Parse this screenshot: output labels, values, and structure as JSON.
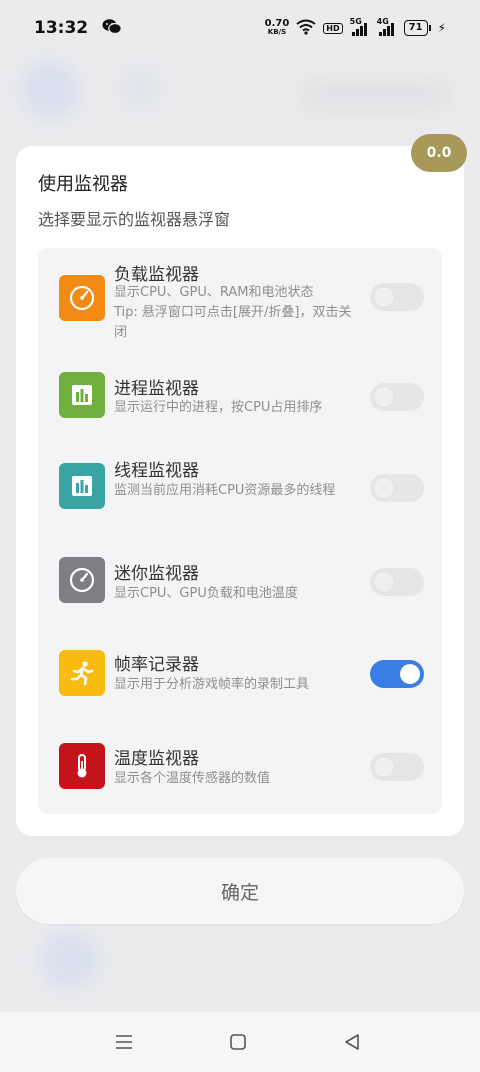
{
  "status_bar": {
    "time": "13:32",
    "speed_value": "0.70",
    "speed_unit": "KB/S",
    "hd_label": "HD",
    "net1": "5G",
    "net2": "4G",
    "battery": "71"
  },
  "dialog": {
    "badge": "0.0",
    "title": "使用监视器",
    "subtitle": "选择要显示的监视器悬浮窗",
    "items": [
      {
        "title": "负载监视器",
        "desc": "显示CPU、GPU、RAM和电池状态\nTip: 悬浮窗口可点击[展开/折叠]，双击关闭",
        "enabled": false,
        "color": "#f28a14",
        "icon": "gauge-icon"
      },
      {
        "title": "进程监视器",
        "desc": "显示运行中的进程，按CPU占用排序",
        "enabled": false,
        "color": "#6fb03e",
        "icon": "bar-chart-icon"
      },
      {
        "title": "线程监视器",
        "desc": "监测当前应用消耗CPU资源最多的线程",
        "enabled": false,
        "color": "#3aa3a6",
        "icon": "bar-chart-icon"
      },
      {
        "title": "迷你监视器",
        "desc": "显示CPU、GPU负载和电池温度",
        "enabled": false,
        "color": "#7e7e84",
        "icon": "gauge-icon"
      },
      {
        "title": "帧率记录器",
        "desc": "显示用于分析游戏帧率的录制工具",
        "enabled": true,
        "color": "#f8bb10",
        "icon": "running-icon"
      },
      {
        "title": "温度监视器",
        "desc": "显示各个温度传感器的数值",
        "enabled": false,
        "color": "#c2141a",
        "icon": "thermometer-icon"
      }
    ],
    "confirm_label": "确定"
  },
  "colors": {
    "toggle_on": "#3a7ee5",
    "badge": "#a8985a"
  }
}
